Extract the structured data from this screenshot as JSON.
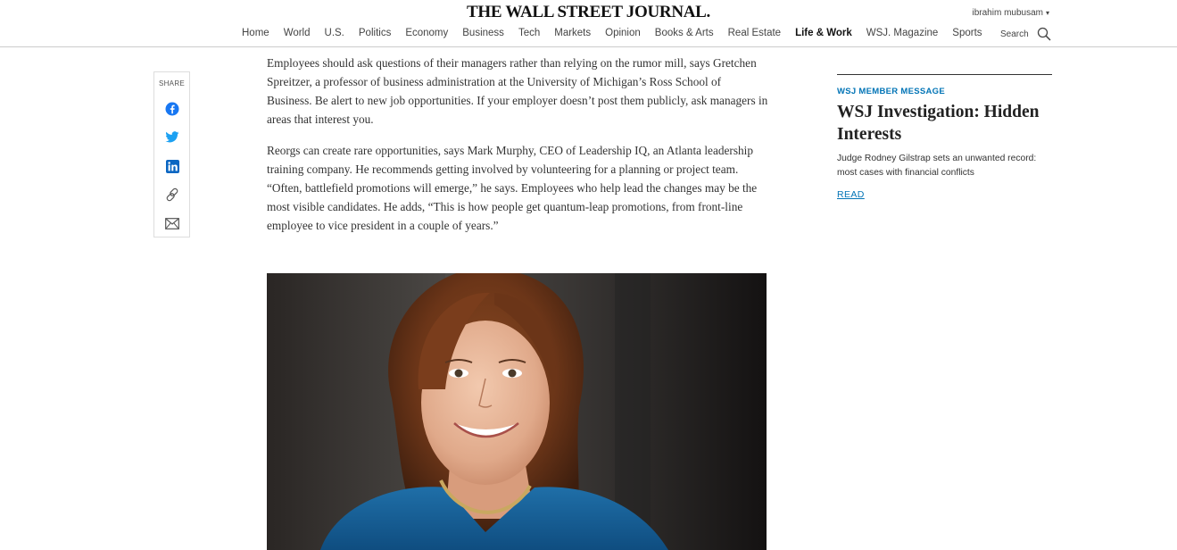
{
  "header": {
    "masthead": "THE WALL STREET JOURNAL.",
    "user_name": "ibrahim mubusam",
    "user_caret": "▾",
    "nav": [
      {
        "label": "Home"
      },
      {
        "label": "World"
      },
      {
        "label": "U.S."
      },
      {
        "label": "Politics"
      },
      {
        "label": "Economy"
      },
      {
        "label": "Business"
      },
      {
        "label": "Tech"
      },
      {
        "label": "Markets"
      },
      {
        "label": "Opinion"
      },
      {
        "label": "Books & Arts"
      },
      {
        "label": "Real Estate"
      },
      {
        "label": "Life & Work"
      },
      {
        "label": "WSJ. Magazine"
      },
      {
        "label": "Sports"
      }
    ],
    "active_nav": "Life & Work",
    "search_label": "Search",
    "search_icon": "search-icon"
  },
  "share": {
    "label": "SHARE",
    "buttons": [
      {
        "name": "facebook",
        "icon": "facebook-icon",
        "color": "#1877f2"
      },
      {
        "name": "twitter",
        "icon": "twitter-icon",
        "color": "#1da1f2"
      },
      {
        "name": "linkedin",
        "icon": "linkedin-icon",
        "color": "#0a66c2"
      },
      {
        "name": "copy-link",
        "icon": "link-icon",
        "color": "#555555"
      },
      {
        "name": "email",
        "icon": "envelope-icon",
        "color": "#555555"
      }
    ]
  },
  "article": {
    "paragraphs": [
      "Employees should ask questions of their managers rather than relying on the rumor mill, says Gretchen Spreitzer, a professor of business administration at the University of Michigan’s Ross School of Business. Be alert to new job opportunities. If your employer doesn’t post them publicly, ask managers in areas that interest you.",
      "Reorgs can create rare opportunities, says Mark Murphy, CEO of Leadership IQ, an Atlanta leadership training company. He recommends getting involved by volunteering for a planning or project team. “Often, battlefield promotions will emerge,” he says. Employees who help lead the changes may be the most visible candidates. He adds, “This is how people get quantum-leap promotions, from front-line employee to vice president in a couple of years.”"
    ]
  },
  "sidebar": {
    "kicker": "WSJ MEMBER MESSAGE",
    "headline": "WSJ Investigation: Hidden Interests",
    "summary": "Judge Rodney Gilstrap sets an unwanted record: most cases with financial conflicts",
    "cta": "READ"
  },
  "colors": {
    "accent": "#0274b6",
    "text": "#333333",
    "rule": "#cccccc"
  }
}
